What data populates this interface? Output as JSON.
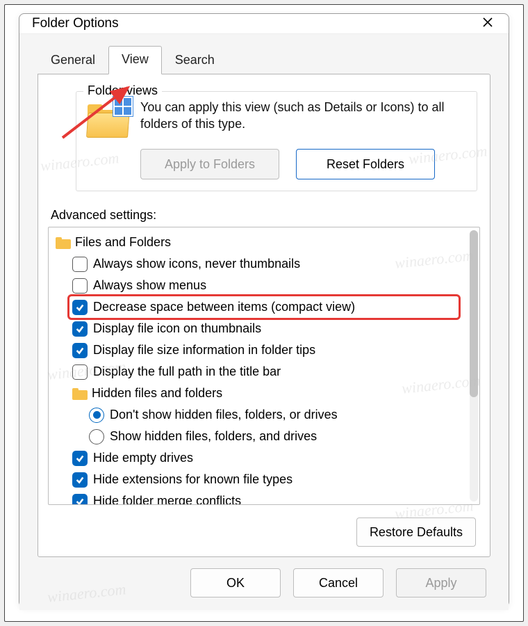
{
  "window": {
    "title": "Folder Options"
  },
  "tabs": {
    "general": "General",
    "view": "View",
    "search": "Search",
    "active": "view"
  },
  "folder_views": {
    "legend": "Folder views",
    "description": "You can apply this view (such as Details or Icons) to all folders of this type.",
    "apply_btn": "Apply to Folders",
    "reset_btn": "Reset Folders"
  },
  "advanced": {
    "label": "Advanced settings:",
    "items": [
      {
        "type": "folder",
        "indent": 1,
        "label": "Files and Folders"
      },
      {
        "type": "check",
        "indent": 2,
        "checked": false,
        "label": "Always show icons, never thumbnails"
      },
      {
        "type": "check",
        "indent": 2,
        "checked": false,
        "label": "Always show menus"
      },
      {
        "type": "check",
        "indent": 2,
        "checked": true,
        "label": "Decrease space between items (compact view)",
        "highlighted": true
      },
      {
        "type": "check",
        "indent": 2,
        "checked": true,
        "label": "Display file icon on thumbnails"
      },
      {
        "type": "check",
        "indent": 2,
        "checked": true,
        "label": "Display file size information in folder tips"
      },
      {
        "type": "check",
        "indent": 2,
        "checked": false,
        "label": "Display the full path in the title bar"
      },
      {
        "type": "folder",
        "indent": 2,
        "label": "Hidden files and folders"
      },
      {
        "type": "radio",
        "indent": 3,
        "selected": true,
        "label": "Don't show hidden files, folders, or drives"
      },
      {
        "type": "radio",
        "indent": 3,
        "selected": false,
        "label": "Show hidden files, folders, and drives"
      },
      {
        "type": "check",
        "indent": 2,
        "checked": true,
        "label": "Hide empty drives"
      },
      {
        "type": "check",
        "indent": 2,
        "checked": true,
        "label": "Hide extensions for known file types"
      },
      {
        "type": "check",
        "indent": 2,
        "checked": true,
        "label": "Hide folder merge conflicts"
      }
    ]
  },
  "buttons": {
    "restore_defaults": "Restore Defaults",
    "ok": "OK",
    "cancel": "Cancel",
    "apply": "Apply"
  },
  "watermark": "winaero.com"
}
